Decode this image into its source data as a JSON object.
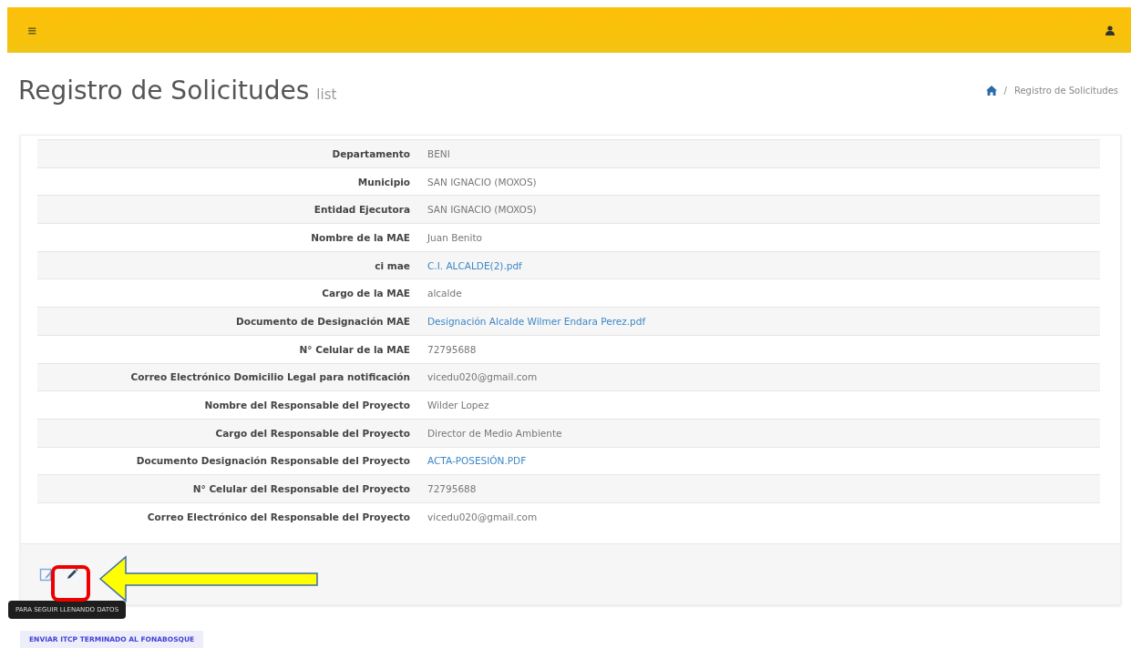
{
  "header": {
    "menu_icon": "≡"
  },
  "page": {
    "title": "Registro de Solicitudes",
    "subtitle": "list",
    "breadcrumb": {
      "separator": "/",
      "items": [
        "Registro de Solicitudes"
      ]
    }
  },
  "details": [
    {
      "label": "Departamento",
      "value": "BENI",
      "kind": "text"
    },
    {
      "label": "Municipio",
      "value": "SAN IGNACIO (MOXOS)",
      "kind": "text"
    },
    {
      "label": "Entidad Ejecutora",
      "value": "SAN IGNACIO (MOXOS)",
      "kind": "text"
    },
    {
      "label": "Nombre de la MAE",
      "value": "Juan Benito",
      "kind": "text"
    },
    {
      "label": "ci mae",
      "value": "C.I. ALCALDE(2).pdf",
      "kind": "link"
    },
    {
      "label": "Cargo de la MAE",
      "value": "alcalde",
      "kind": "text"
    },
    {
      "label": "Documento de Designación MAE",
      "value": "Designación Alcalde Wilmer Endara Perez.pdf",
      "kind": "link"
    },
    {
      "label": "N° Celular de la MAE",
      "value": "72795688",
      "kind": "text"
    },
    {
      "label": "Correo Electrónico Domicilio Legal para notificación",
      "value": "vicedu020@gmail.com",
      "kind": "text"
    },
    {
      "label": "Nombre del Responsable del Proyecto",
      "value": "Wilder Lopez",
      "kind": "text"
    },
    {
      "label": "Cargo del Responsable del Proyecto",
      "value": "Director de Medio Ambiente",
      "kind": "text"
    },
    {
      "label": "Documento Designación Responsable del Proyecto",
      "value": "ACTA-POSESIÓN.PDF",
      "kind": "link"
    },
    {
      "label": "N° Celular del Responsable del Proyecto",
      "value": "72795688",
      "kind": "text"
    },
    {
      "label": "Correo Electrónico del Responsable del Proyecto",
      "value": "vicedu020@gmail.com",
      "kind": "text"
    }
  ],
  "tooltip": "PARA SEGUIR LLENANDO DATOS",
  "submit_button": "ENVIAR ITCP TERMINADO AL FONABOSQUE"
}
